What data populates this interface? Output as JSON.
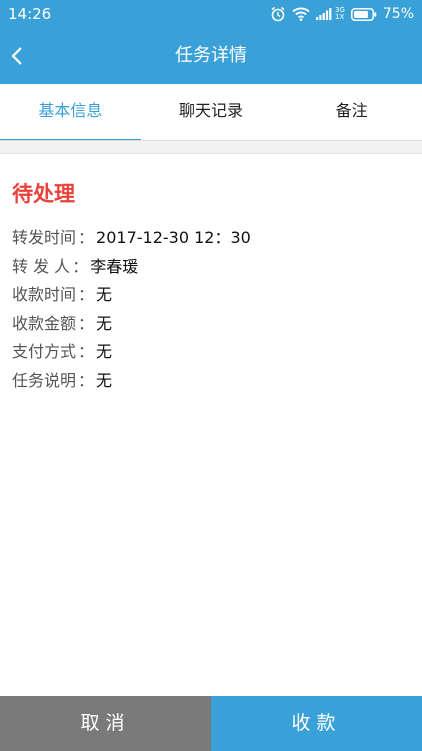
{
  "status_bar": {
    "time": "14:26",
    "network": [
      "3G",
      "1X"
    ],
    "battery": "75%"
  },
  "header": {
    "title": "任务详情"
  },
  "tabs": [
    {
      "label": "基本信息",
      "active": true
    },
    {
      "label": "聊天记录",
      "active": false
    },
    {
      "label": "备注",
      "active": false
    }
  ],
  "task": {
    "status": "待处理",
    "fields": [
      {
        "label": "转发时间",
        "value": "2017-12-30  12：30"
      },
      {
        "label": "转  发  人",
        "value": "李春瑗"
      },
      {
        "label": "收款时间",
        "value": "无"
      },
      {
        "label": "收款金额",
        "value": "无"
      },
      {
        "label": "支付方式",
        "value": "无"
      },
      {
        "label": "任务说明",
        "value": "无"
      }
    ],
    "separator": "："
  },
  "bottom": {
    "cancel_label": "取消",
    "collect_label": "收款"
  },
  "colors": {
    "accent": "#3aa0d8",
    "status_red": "#e8433b",
    "cancel_gray": "#7a7a7a"
  },
  "icons": [
    "alarm-icon",
    "wifi-icon",
    "signal-icon",
    "battery-icon",
    "back-arrow-icon"
  ]
}
